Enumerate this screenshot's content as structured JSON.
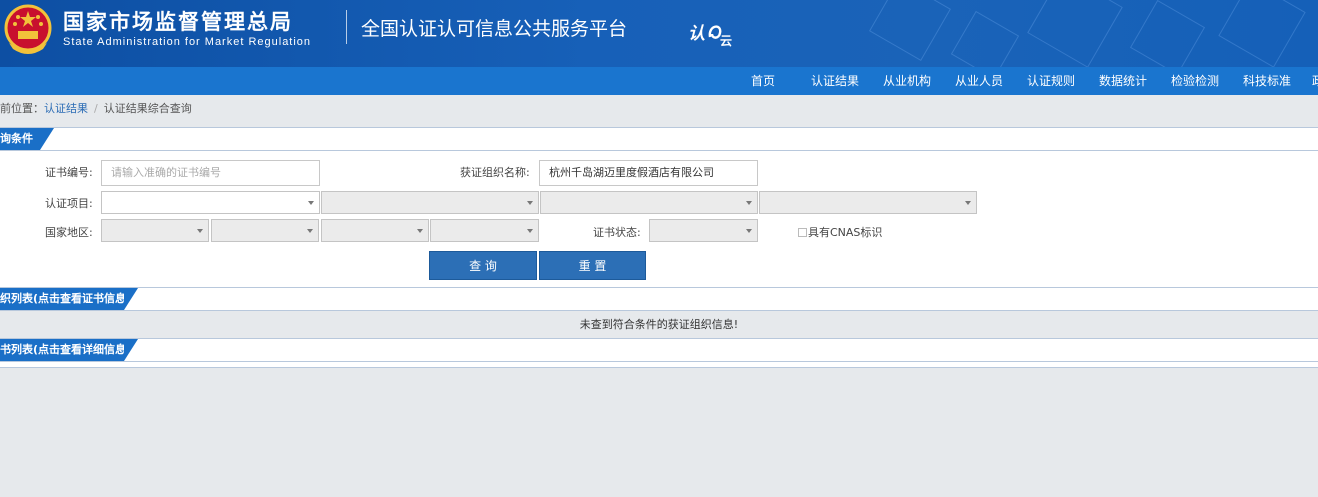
{
  "header": {
    "cn_title": "国家市场监督管理总局",
    "en_title": "State Administration  for  Market Regulation",
    "platform_title": "全国认证认可信息公共服务平台",
    "logo_text": "认e云"
  },
  "nav": {
    "items": [
      "首页",
      "认证结果",
      "从业机构",
      "从业人员",
      "认证规则",
      "数据统计",
      "检验检测",
      "科技标准",
      "政"
    ]
  },
  "breadcrumb": {
    "prefix": "前位置：",
    "link": "认证结果",
    "current": "认证结果综合查询"
  },
  "query": {
    "section_title": "询条件",
    "cert_no_label": "证书编号:",
    "cert_no_placeholder": "请输入准确的证书编号",
    "org_name_label": "获证组织名称:",
    "org_name_value": "杭州千岛湖迈里度假酒店有限公司",
    "cert_item_label": "认证项目:",
    "region_label": "国家地区:",
    "cert_status_label": "证书状态:",
    "cnas_label": "具有CNAS标识",
    "search_button": "查 询",
    "reset_button": "重 置"
  },
  "org_list": {
    "section_title": "织列表(点击查看证书信息)",
    "empty_message": "未查到符合条件的获证组织信息!"
  },
  "cert_list": {
    "section_title": "书列表(点击查看详细信息)"
  },
  "colors": {
    "banner": "#1760b8",
    "nav": "#1a75cf",
    "accent": "#1a6fc7",
    "button": "#2c6fb6"
  }
}
